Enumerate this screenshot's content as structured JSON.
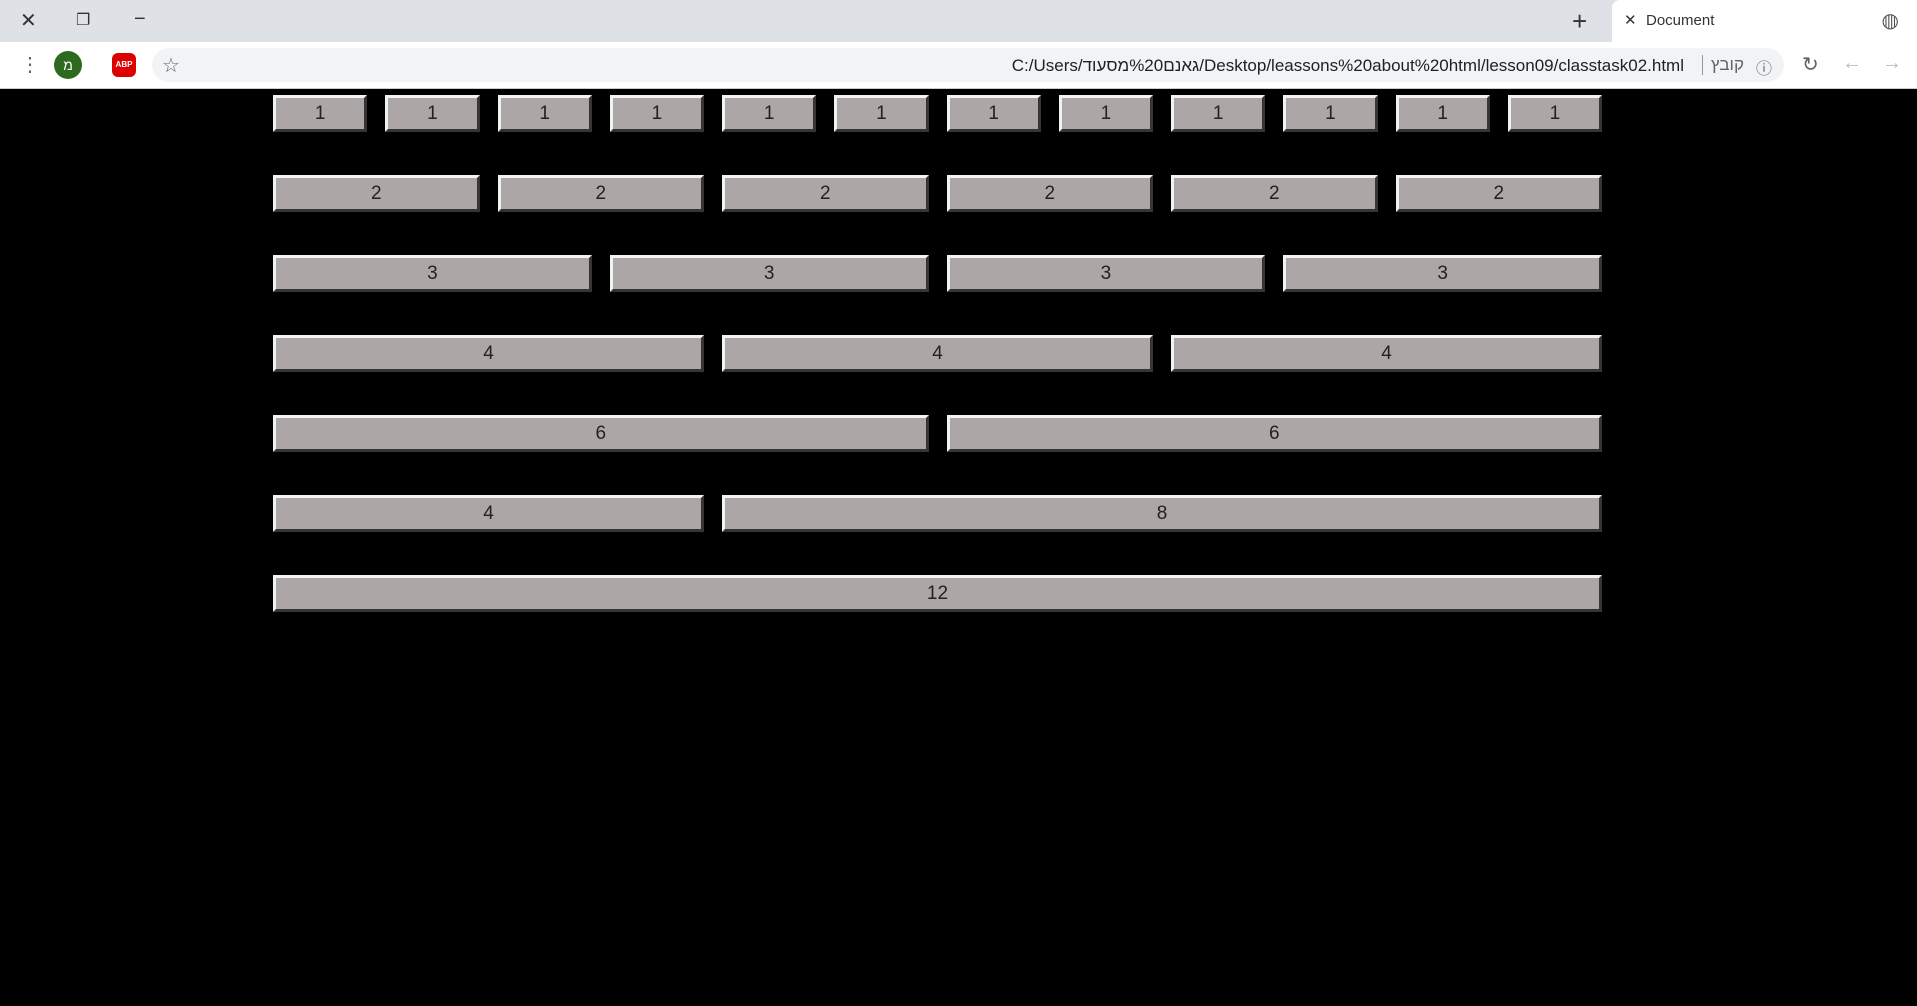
{
  "browser": {
    "tab_title": "Document",
    "url": "C:/Users/גאנם%20מסעוד/Desktop/leassons%20about%20html/lesson09/classtask02.html",
    "scheme_label": "קובץ",
    "profile_initial": "מ",
    "adblock_label": "ABP"
  },
  "rows": [
    {
      "cells": [
        {
          "label": "1",
          "span": 1
        },
        {
          "label": "1",
          "span": 1
        },
        {
          "label": "1",
          "span": 1
        },
        {
          "label": "1",
          "span": 1
        },
        {
          "label": "1",
          "span": 1
        },
        {
          "label": "1",
          "span": 1
        },
        {
          "label": "1",
          "span": 1
        },
        {
          "label": "1",
          "span": 1
        },
        {
          "label": "1",
          "span": 1
        },
        {
          "label": "1",
          "span": 1
        },
        {
          "label": "1",
          "span": 1
        },
        {
          "label": "1",
          "span": 1
        }
      ]
    },
    {
      "cells": [
        {
          "label": "2",
          "span": 2
        },
        {
          "label": "2",
          "span": 2
        },
        {
          "label": "2",
          "span": 2
        },
        {
          "label": "2",
          "span": 2
        },
        {
          "label": "2",
          "span": 2
        },
        {
          "label": "2",
          "span": 2
        }
      ]
    },
    {
      "cells": [
        {
          "label": "3",
          "span": 3
        },
        {
          "label": "3",
          "span": 3
        },
        {
          "label": "3",
          "span": 3
        },
        {
          "label": "3",
          "span": 3
        }
      ]
    },
    {
      "cells": [
        {
          "label": "4",
          "span": 4
        },
        {
          "label": "4",
          "span": 4
        },
        {
          "label": "4",
          "span": 4
        }
      ]
    },
    {
      "cells": [
        {
          "label": "6",
          "span": 6
        },
        {
          "label": "6",
          "span": 6
        }
      ]
    },
    {
      "cells": [
        {
          "label": "4",
          "span": 4
        },
        {
          "label": "8",
          "span": 8
        }
      ]
    },
    {
      "cells": [
        {
          "label": "12",
          "span": 12
        }
      ]
    }
  ]
}
